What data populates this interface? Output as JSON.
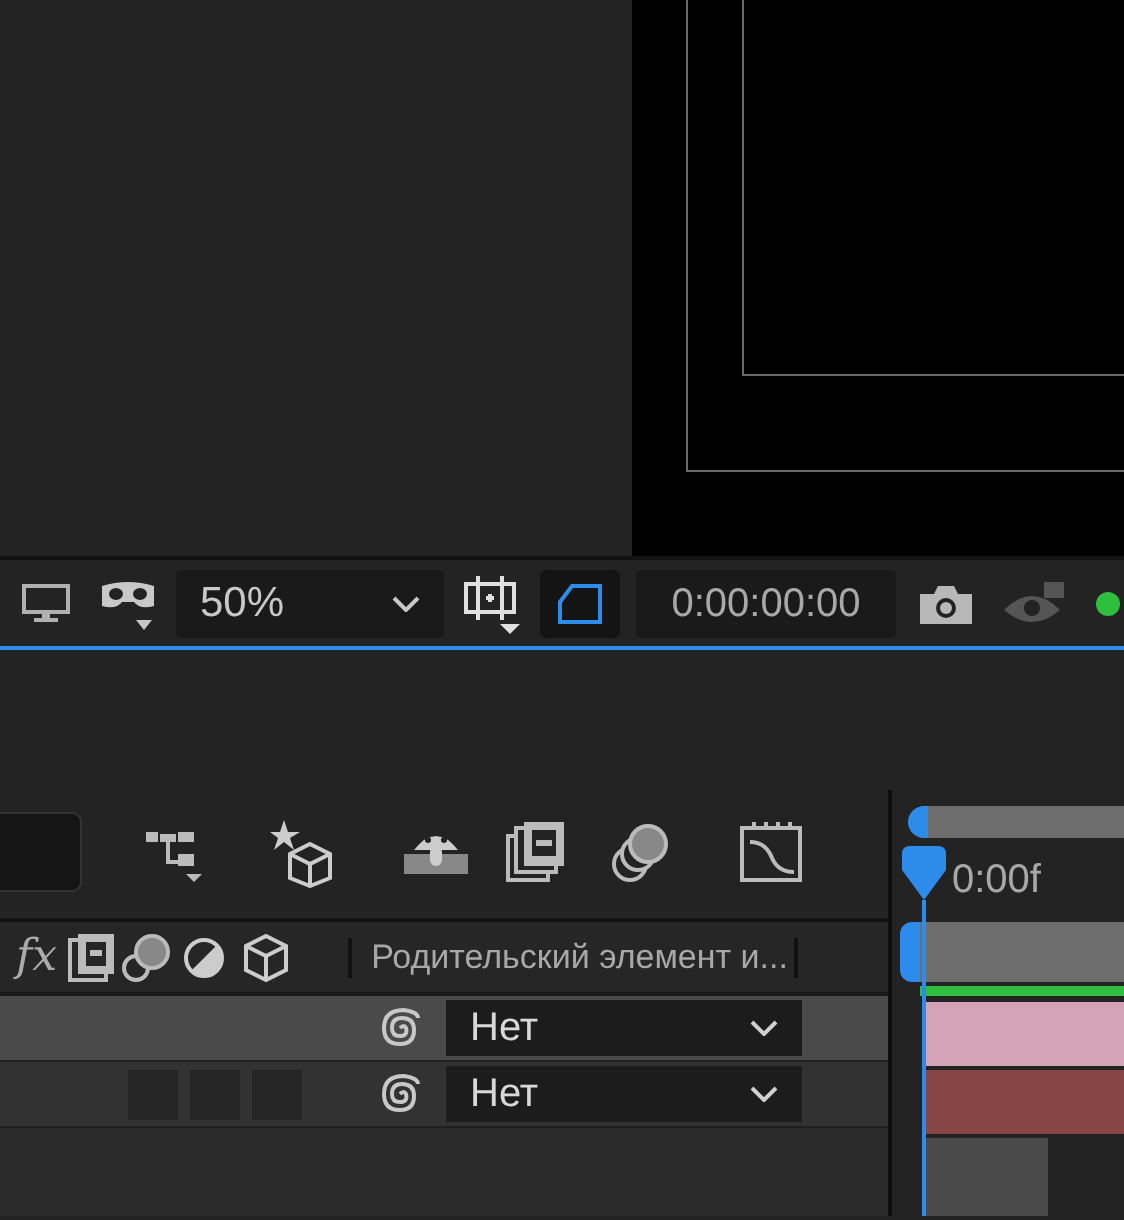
{
  "toolbar": {
    "zoom": "50%",
    "timecode": "0:00:00:00",
    "mask_toggle_on": true
  },
  "layer_header": {
    "fx_label": "fx",
    "column_label": "Родительский элемент и..."
  },
  "timeline": {
    "time": "0:00f"
  },
  "layers": [
    {
      "parent": "Нет",
      "selected": true,
      "switch_boxes": false,
      "color": "#d4a3b6"
    },
    {
      "parent": "Нет",
      "selected": false,
      "switch_boxes": true,
      "color": "#874646"
    }
  ]
}
